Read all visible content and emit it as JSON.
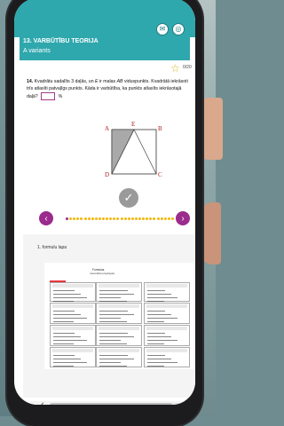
{
  "header": {
    "title": "13. VARBŪTĪBU TEORIJA",
    "subtitle": "A variants",
    "icons": [
      "chat-icon",
      "target-icon"
    ]
  },
  "progress": {
    "score": "0/20",
    "star_icon": "star-outline-icon"
  },
  "task": {
    "number": "14.",
    "text_before": "Kvadrātu sadalīts 3 daļās, un",
    "var_e": "E",
    "text_middle": "ir malas",
    "segment": "AB",
    "text_after": "viduspunkts. Kvadrātā iekrāsoti trīs atlasīti patvaļīgs punkts. Kāda ir varbūtība, ka punkts atlasīts iekrāsotajā daļā?",
    "unit": "%",
    "answer_value": ""
  },
  "figure_labels": {
    "A": "A",
    "E": "E",
    "B": "B",
    "D": "D",
    "C": "C"
  },
  "pagination": {
    "total_dots": 30,
    "active_index": 0
  },
  "formula_sheet": {
    "label": "1. formulu lapa",
    "doc_title": "Formulas",
    "doc_subtitle": "matemātikā (vispārīgais)"
  },
  "colors": {
    "accent": "#2fa8ad",
    "nav": "#9b2b8c",
    "dots": "#f3b70a",
    "star": "#d6b51b"
  }
}
